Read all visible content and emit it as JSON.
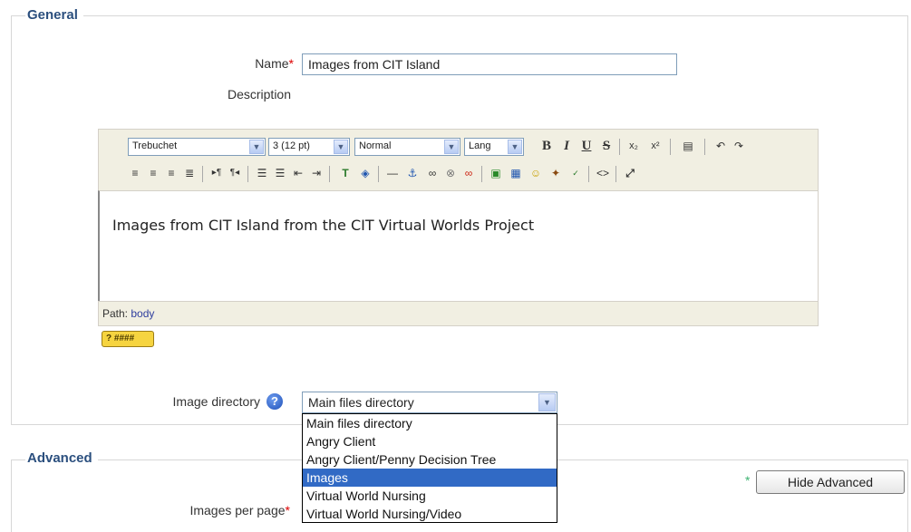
{
  "general": {
    "legend": "General",
    "name_label": "Name",
    "required_mark": "*",
    "name_value": "Images from CIT Island",
    "description_label": "Description"
  },
  "editor": {
    "font_select": "Trebuchet",
    "size_select": "3 (12 pt)",
    "format_select": "Normal",
    "lang_select": "Lang",
    "buttons": {
      "bold": "B",
      "italic": "I",
      "underline": "U",
      "strike": "S",
      "subscript": "x₂",
      "superscript": "x²"
    },
    "content": "Images from CIT Island from the CIT Virtual Worlds Project",
    "path_label": "Path:",
    "path_value": "body",
    "kbd_label": "? ####"
  },
  "image_directory": {
    "label": "Image directory",
    "selected": "Main files directory",
    "options": [
      "Main files directory",
      "Angry Client",
      "Angry Client/Penny Decision Tree",
      "Images",
      "Virtual World Nursing",
      "Virtual World Nursing/Video"
    ],
    "highlighted_index": 3
  },
  "advanced": {
    "legend": "Advanced",
    "images_per_page_label": "Images per page",
    "required_mark": "*",
    "hide_button": "Hide Advanced",
    "star": "*"
  },
  "colors": {
    "legend": "#2b4f7e",
    "required": "#dd0000",
    "highlight": "#316ac5"
  }
}
